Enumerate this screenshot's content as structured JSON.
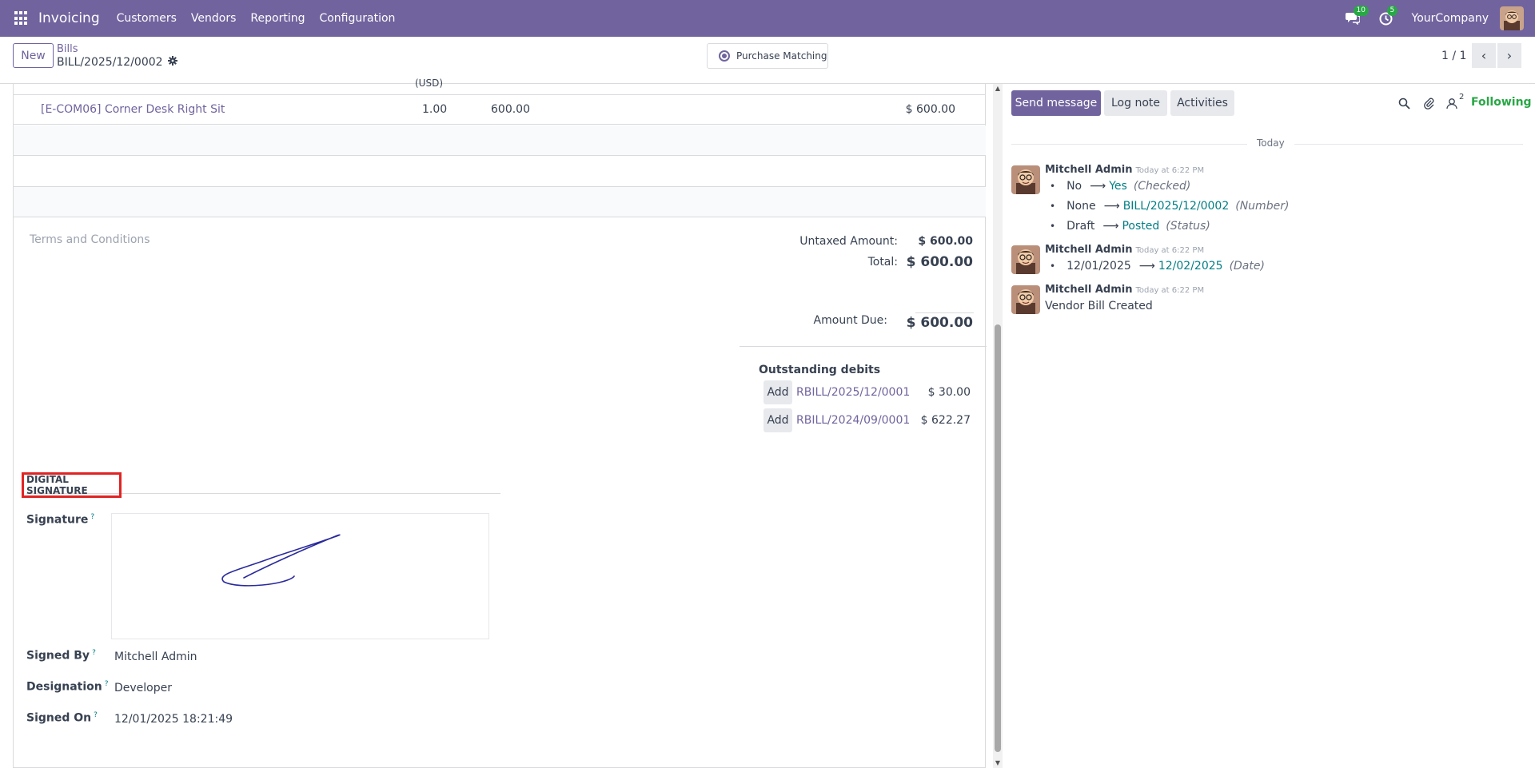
{
  "navbar": {
    "brand": "Invoicing",
    "menu": [
      "Customers",
      "Vendors",
      "Reporting",
      "Configuration"
    ],
    "messages_count": "10",
    "activities_count": "5",
    "company": "YourCompany"
  },
  "control": {
    "new_label": "New",
    "breadcrumb_parent": "Bills",
    "breadcrumb_current": "BILL/2025/12/0002",
    "purchase_matching_label": "Purchase Matching",
    "pager": "1 / 1"
  },
  "lines": {
    "header_partial": "(USD)",
    "rows": [
      {
        "product": "[E-COM06] Corner Desk Right Sit",
        "quantity": "1.00",
        "price": "600.00",
        "subtotal": "$ 600.00"
      }
    ]
  },
  "terms_placeholder": "Terms and Conditions",
  "totals": {
    "untaxed_label": "Untaxed Amount:",
    "untaxed_value": "$ 600.00",
    "total_label": "Total:",
    "total_value": "$ 600.00",
    "amount_due_label": "Amount Due:",
    "amount_due_value": "$ 600.00"
  },
  "outstanding": {
    "title": "Outstanding debits",
    "add_label": "Add",
    "items": [
      {
        "ref": "RBILL/2025/12/0001",
        "amount": "$ 30.00"
      },
      {
        "ref": "RBILL/2024/09/0001",
        "amount": "$ 622.27"
      }
    ]
  },
  "signature": {
    "section_title": "DIGITAL SIGNATURE",
    "signature_label": "Signature",
    "signed_by_label": "Signed By",
    "signed_by_value": "Mitchell Admin",
    "designation_label": "Designation",
    "designation_value": "Developer",
    "signed_on_label": "Signed On",
    "signed_on_value": "12/01/2025 18:21:49",
    "help_mark": "?",
    "ink_color": "#2a2a9c"
  },
  "chatter": {
    "send_message": "Send message",
    "log_note": "Log note",
    "activities": "Activities",
    "followers_count": "2",
    "following": "Following",
    "today_label": "Today",
    "messages": [
      {
        "author": "Mitchell Admin",
        "time": "Today at 6:22 PM",
        "tracking": [
          {
            "old": "No",
            "new": "Yes",
            "field": "(Checked)"
          },
          {
            "old": "None",
            "new": "BILL/2025/12/0002",
            "field": "(Number)"
          },
          {
            "old": "Draft",
            "new": "Posted",
            "field": "(Status)"
          }
        ]
      },
      {
        "author": "Mitchell Admin",
        "time": "Today at 6:22 PM",
        "tracking": [
          {
            "old": "12/01/2025",
            "new": "12/02/2025",
            "field": "(Date)"
          }
        ]
      },
      {
        "author": "Mitchell Admin",
        "time": "Today at 6:22 PM",
        "body": "Vendor Bill Created"
      }
    ]
  },
  "colors": {
    "brand": "#71639e",
    "link_teal": "#017e84",
    "following_green": "#28a745",
    "highlight_red": "#e02424"
  }
}
